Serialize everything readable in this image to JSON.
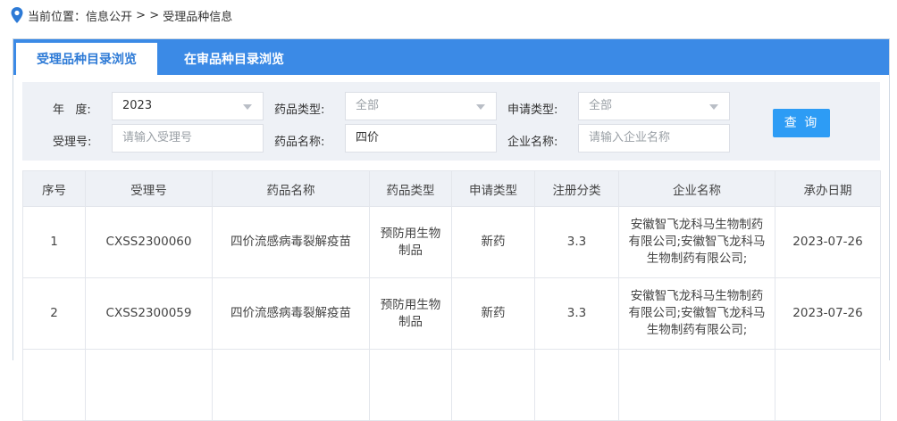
{
  "breadcrumb": {
    "prefix": "当前位置：",
    "section": "信息公开",
    "sep": " > > ",
    "page": "受理品种信息"
  },
  "tabs": [
    {
      "label": "受理品种目录浏览",
      "active": true
    },
    {
      "label": "在审品种目录浏览",
      "active": false
    }
  ],
  "filters": {
    "year_label": "年   度:",
    "year_value": "2023",
    "drug_type_label": "药品类型:",
    "drug_type_value": "全部",
    "apply_type_label": "申请类型:",
    "apply_type_value": "全部",
    "accept_no_label": "受理号:",
    "accept_no_placeholder": "请输入受理号",
    "drug_name_label": "药品名称:",
    "drug_name_value": "四价",
    "company_label": "企业名称:",
    "company_placeholder": "请输入企业名称",
    "query_label": "查 询"
  },
  "table": {
    "columns": [
      "序号",
      "受理号",
      "药品名称",
      "药品类型",
      "申请类型",
      "注册分类",
      "企业名称",
      "承办日期"
    ],
    "rows": [
      [
        "1",
        "CXSS2300060",
        "四价流感病毒裂解疫苗",
        "预防用生物制品",
        "新药",
        "3.3",
        "安徽智飞龙科马生物制药有限公司;安徽智飞龙科马生物制药有限公司;",
        "2023-07-26"
      ],
      [
        "2",
        "CXSS2300059",
        "四价流感病毒裂解疫苗",
        "预防用生物制品",
        "新药",
        "3.3",
        "安徽智飞龙科马生物制药有限公司;安徽智飞龙科马生物制药有限公司;",
        "2023-07-26"
      ],
      [
        "",
        "",
        "",
        "",
        "",
        "",
        "",
        ""
      ]
    ]
  },
  "colors": {
    "accent": "#3b8ae6",
    "button": "#2d9cf5",
    "header_bg": "#eef1f6"
  }
}
